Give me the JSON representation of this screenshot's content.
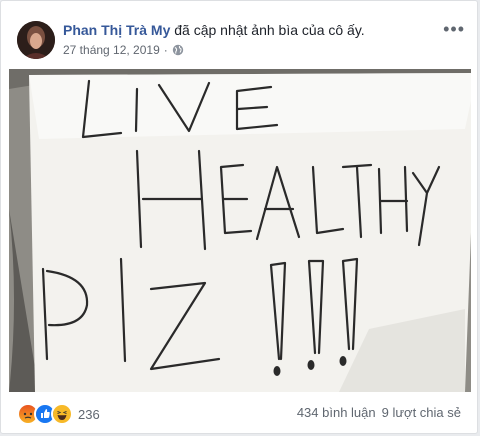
{
  "post": {
    "author": "Phan Thị Trà My",
    "action": " đã cập nhật ảnh bìa của cô ấy.",
    "date": "27 tháng 12, 2019",
    "dot": "·",
    "more": "•••",
    "privacy_icon": "globe-icon"
  },
  "photo": {
    "handwriting": [
      "LIVE",
      "HEALTHY",
      "PlZ !!!"
    ]
  },
  "footer": {
    "reactions": [
      "angry",
      "like",
      "haha"
    ],
    "reaction_count": "236",
    "comments": "434 bình luận",
    "shares": "9 lượt chia sẻ"
  }
}
